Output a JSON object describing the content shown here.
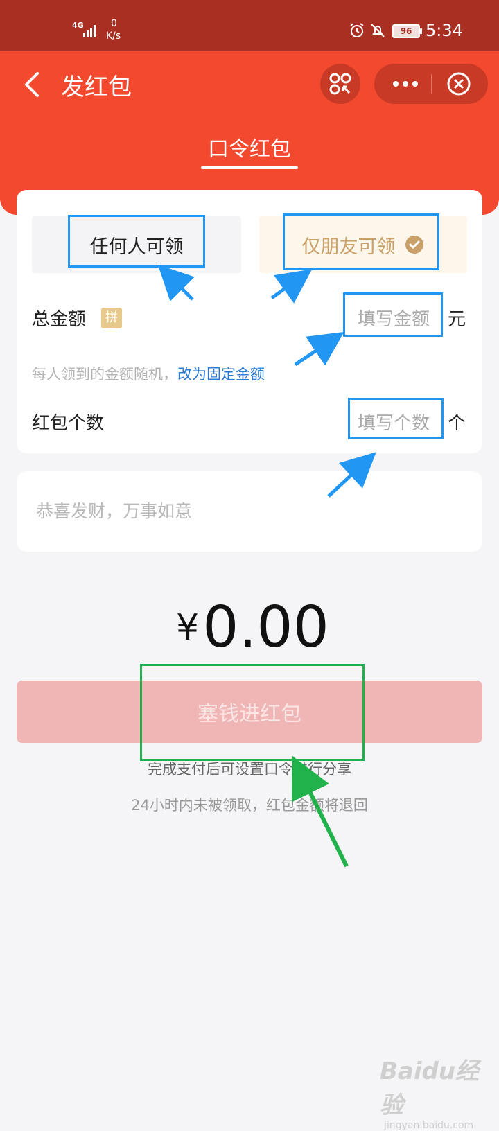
{
  "status_bar": {
    "network": "4G",
    "speed_value": "0",
    "speed_unit": "K/s",
    "battery": "96",
    "time": "5:34"
  },
  "nav": {
    "title": "发红包"
  },
  "tab": {
    "label": "口令红包"
  },
  "options": {
    "anyone": "任何人可领",
    "friends_only": "仅朋友可领"
  },
  "amount": {
    "label": "总金额",
    "badge": "拼",
    "placeholder": "填写金额",
    "unit": "元",
    "hint": "每人领到的金额随机，",
    "switch_link": "改为固定金额"
  },
  "count": {
    "label": "红包个数",
    "placeholder": "填写个数",
    "unit": "个"
  },
  "message": {
    "placeholder": "恭喜发财，万事如意"
  },
  "total": {
    "currency": "¥",
    "value": "0.00"
  },
  "submit": {
    "label": "塞钱进红包"
  },
  "notes": {
    "line1": "完成支付后可设置口令进行分享",
    "line2": "24小时内未被领取，红包金额将退回"
  },
  "watermark": {
    "text": "Baidu经验",
    "url": "jingyan.baidu.com"
  },
  "colors": {
    "header_red": "#f2492f",
    "status_red": "#a92f22",
    "link_blue": "#2b7bd6",
    "button_disabled": "#efb6b5",
    "gold": "#c9a06a",
    "highlight_blue": "#2196f3",
    "highlight_green": "#22b24c"
  }
}
